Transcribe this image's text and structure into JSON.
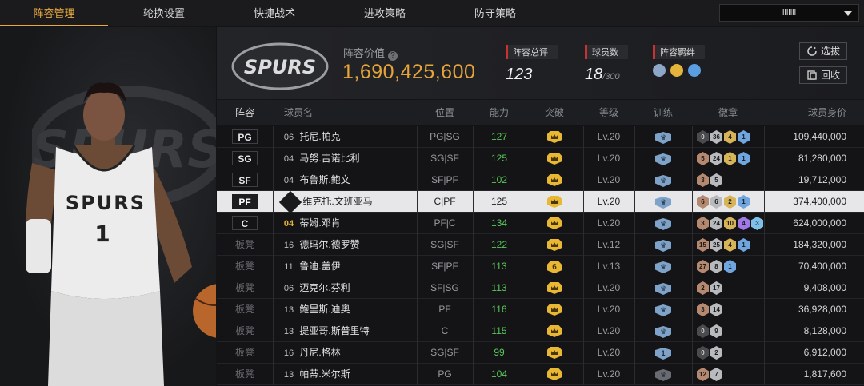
{
  "nav": {
    "tabs": [
      "阵容管理",
      "轮换设置",
      "快捷战术",
      "进攻策略",
      "防守策略"
    ],
    "dropdown_value": "iiiiiii"
  },
  "team": {
    "logo_text": "SPURS",
    "value_label": "阵容价值",
    "value": "1,690,425,600",
    "overall_label": "阵容总评",
    "overall": "123",
    "player_count_label": "球员数",
    "player_count": "18",
    "player_count_max": "/300",
    "bond_label": "阵容羁绊",
    "bond_colors": [
      "#8da7c8",
      "#e5b43a",
      "#5a9de0"
    ]
  },
  "buttons": {
    "select": "选拔",
    "recycle": "回收"
  },
  "table": {
    "headers": [
      "阵容",
      "球员名",
      "位置",
      "能力",
      "突破",
      "等级",
      "训练",
      "徽章",
      "球员身价"
    ],
    "rows": [
      {
        "slot": "PG",
        "bench": false,
        "num": "06",
        "num_style": "normal",
        "name": "托尼.帕克",
        "pos": "PG|SG",
        "ability": "127",
        "breakthrough": "",
        "level": "Lv.20",
        "train": "",
        "badges": [
          [
            "b-dark",
            "0"
          ],
          [
            "b-silver",
            "36"
          ],
          [
            "b-gold",
            "4"
          ],
          [
            "b-blue",
            "1"
          ]
        ],
        "salary": "109,440,000"
      },
      {
        "slot": "SG",
        "bench": false,
        "num": "04",
        "num_style": "normal",
        "name": "马努.吉诺比利",
        "pos": "SG|SF",
        "ability": "125",
        "breakthrough": "",
        "level": "Lv.20",
        "train": "",
        "badges": [
          [
            "b-bronze",
            "5"
          ],
          [
            "b-silver",
            "24"
          ],
          [
            "b-gold",
            "1"
          ],
          [
            "b-blue",
            "1"
          ]
        ],
        "salary": "81,280,000"
      },
      {
        "slot": "SF",
        "bench": false,
        "num": "04",
        "num_style": "normal",
        "name": "布鲁斯.鲍文",
        "pos": "SF|PF",
        "ability": "102",
        "breakthrough": "",
        "level": "Lv.20",
        "train": "",
        "badges": [
          [
            "b-bronze",
            "3"
          ],
          [
            "b-silver",
            "5"
          ]
        ],
        "salary": "19,712,000"
      },
      {
        "slot": "PF",
        "bench": false,
        "num": "01",
        "num_style": "star",
        "name": "维克托.文班亚马",
        "pos": "C|PF",
        "ability": "125",
        "breakthrough": "",
        "level": "Lv.20",
        "train": "",
        "badges": [
          [
            "b-bronze",
            "6"
          ],
          [
            "b-silver",
            "6"
          ],
          [
            "b-gold",
            "2"
          ],
          [
            "b-blue",
            "1"
          ]
        ],
        "salary": "374,400,000"
      },
      {
        "slot": "C",
        "bench": false,
        "num": "04",
        "num_style": "gold",
        "name": "蒂姆.邓肯",
        "pos": "PF|C",
        "ability": "134",
        "breakthrough": "",
        "level": "Lv.20",
        "train": "",
        "badges": [
          [
            "b-bronze",
            "3"
          ],
          [
            "b-silver",
            "24"
          ],
          [
            "b-gold",
            "10"
          ],
          [
            "b-purple",
            "4"
          ],
          [
            "b-cyan",
            "3"
          ]
        ],
        "salary": "624,000,000"
      },
      {
        "slot": "板凳",
        "bench": true,
        "num": "16",
        "num_style": "normal",
        "name": "德玛尔.德罗赞",
        "pos": "SG|SF",
        "ability": "122",
        "breakthrough": "",
        "level": "Lv.12",
        "train": "",
        "badges": [
          [
            "b-bronze",
            "15"
          ],
          [
            "b-silver",
            "25"
          ],
          [
            "b-gold",
            "4"
          ],
          [
            "b-blue",
            "1"
          ]
        ],
        "salary": "184,320,000"
      },
      {
        "slot": "板凳",
        "bench": true,
        "num": "11",
        "num_style": "normal",
        "name": "鲁迪.盖伊",
        "pos": "SF|PF",
        "ability": "113",
        "breakthrough": "6",
        "level": "Lv.13",
        "train": "",
        "badges": [
          [
            "b-bronze",
            "27"
          ],
          [
            "b-silver",
            "8"
          ],
          [
            "b-blue",
            "1"
          ]
        ],
        "salary": "70,400,000"
      },
      {
        "slot": "板凳",
        "bench": true,
        "num": "06",
        "num_style": "normal",
        "name": "迈克尔.芬利",
        "pos": "SF|SG",
        "ability": "113",
        "breakthrough": "",
        "level": "Lv.20",
        "train": "",
        "badges": [
          [
            "b-bronze",
            "2"
          ],
          [
            "b-silver",
            "17"
          ]
        ],
        "salary": "9,408,000"
      },
      {
        "slot": "板凳",
        "bench": true,
        "num": "13",
        "num_style": "normal",
        "name": "鲍里斯.迪奥",
        "pos": "PF",
        "ability": "116",
        "breakthrough": "",
        "level": "Lv.20",
        "train": "",
        "badges": [
          [
            "b-bronze",
            "3"
          ],
          [
            "b-silver",
            "14"
          ]
        ],
        "salary": "36,928,000"
      },
      {
        "slot": "板凳",
        "bench": true,
        "num": "13",
        "num_style": "normal",
        "name": "提亚哥.斯普里特",
        "pos": "C",
        "ability": "115",
        "breakthrough": "",
        "level": "Lv.20",
        "train": "",
        "badges": [
          [
            "b-dark",
            "0"
          ],
          [
            "b-silver",
            "9"
          ]
        ],
        "salary": "8,128,000"
      },
      {
        "slot": "板凳",
        "bench": true,
        "num": "16",
        "num_style": "normal",
        "name": "丹尼.格林",
        "pos": "SG|SF",
        "ability": "99",
        "breakthrough": "",
        "level": "Lv.20",
        "train": "1",
        "badges": [
          [
            "b-dark",
            "0"
          ],
          [
            "b-silver",
            "2"
          ]
        ],
        "salary": "6,912,000"
      },
      {
        "slot": "板凳",
        "bench": true,
        "num": "13",
        "num_style": "normal",
        "name": "帕蒂.米尔斯",
        "pos": "PG",
        "ability": "104",
        "breakthrough": "",
        "level": "Lv.20",
        "train": "",
        "badges": [
          [
            "b-bronze",
            "12"
          ],
          [
            "b-silver",
            "7"
          ]
        ],
        "salary": "1,817,600"
      }
    ]
  },
  "selected_row": 3,
  "colors": {
    "accent": "#e9a93c",
    "ability_green": "#58c85a",
    "crown_gold": "#e8b734"
  }
}
